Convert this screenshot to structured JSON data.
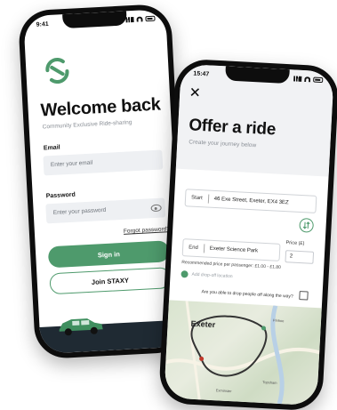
{
  "colors": {
    "brand_green": "#4e9a6c",
    "dark_navy": "#1f2a33"
  },
  "login": {
    "status_time": "9:41",
    "logo_icon": "staxy-arrows-logo",
    "title": "Welcome back",
    "subtitle": "Community Exclusive Ride-sharing",
    "email_label": "Email",
    "email_placeholder": "Enter your email",
    "password_label": "Password",
    "password_placeholder": "Enter your password",
    "forgot_label": "Forgot password?",
    "signin_label": "Sign in",
    "join_label": "Join STAXY"
  },
  "offer": {
    "status_time": "15:47",
    "title": "Offer a ride",
    "subtitle": "Create your journey below",
    "start_tag": "Start",
    "start_value": "46 Exe Street, Exeter, EX4 3EZ",
    "end_tag": "End",
    "end_value": "Exeter Science Park",
    "price_label": "Price (£)",
    "price_value": "2",
    "recommended": "Recommended price per passenger: £1.00 - £1.80",
    "dropoff_placeholder": "Add drop-off location",
    "question": "Are you able to drop people off along the way?",
    "map_city": "Exeter",
    "map_places": [
      "Pinhoe",
      "Topsham",
      "Exminster"
    ]
  }
}
